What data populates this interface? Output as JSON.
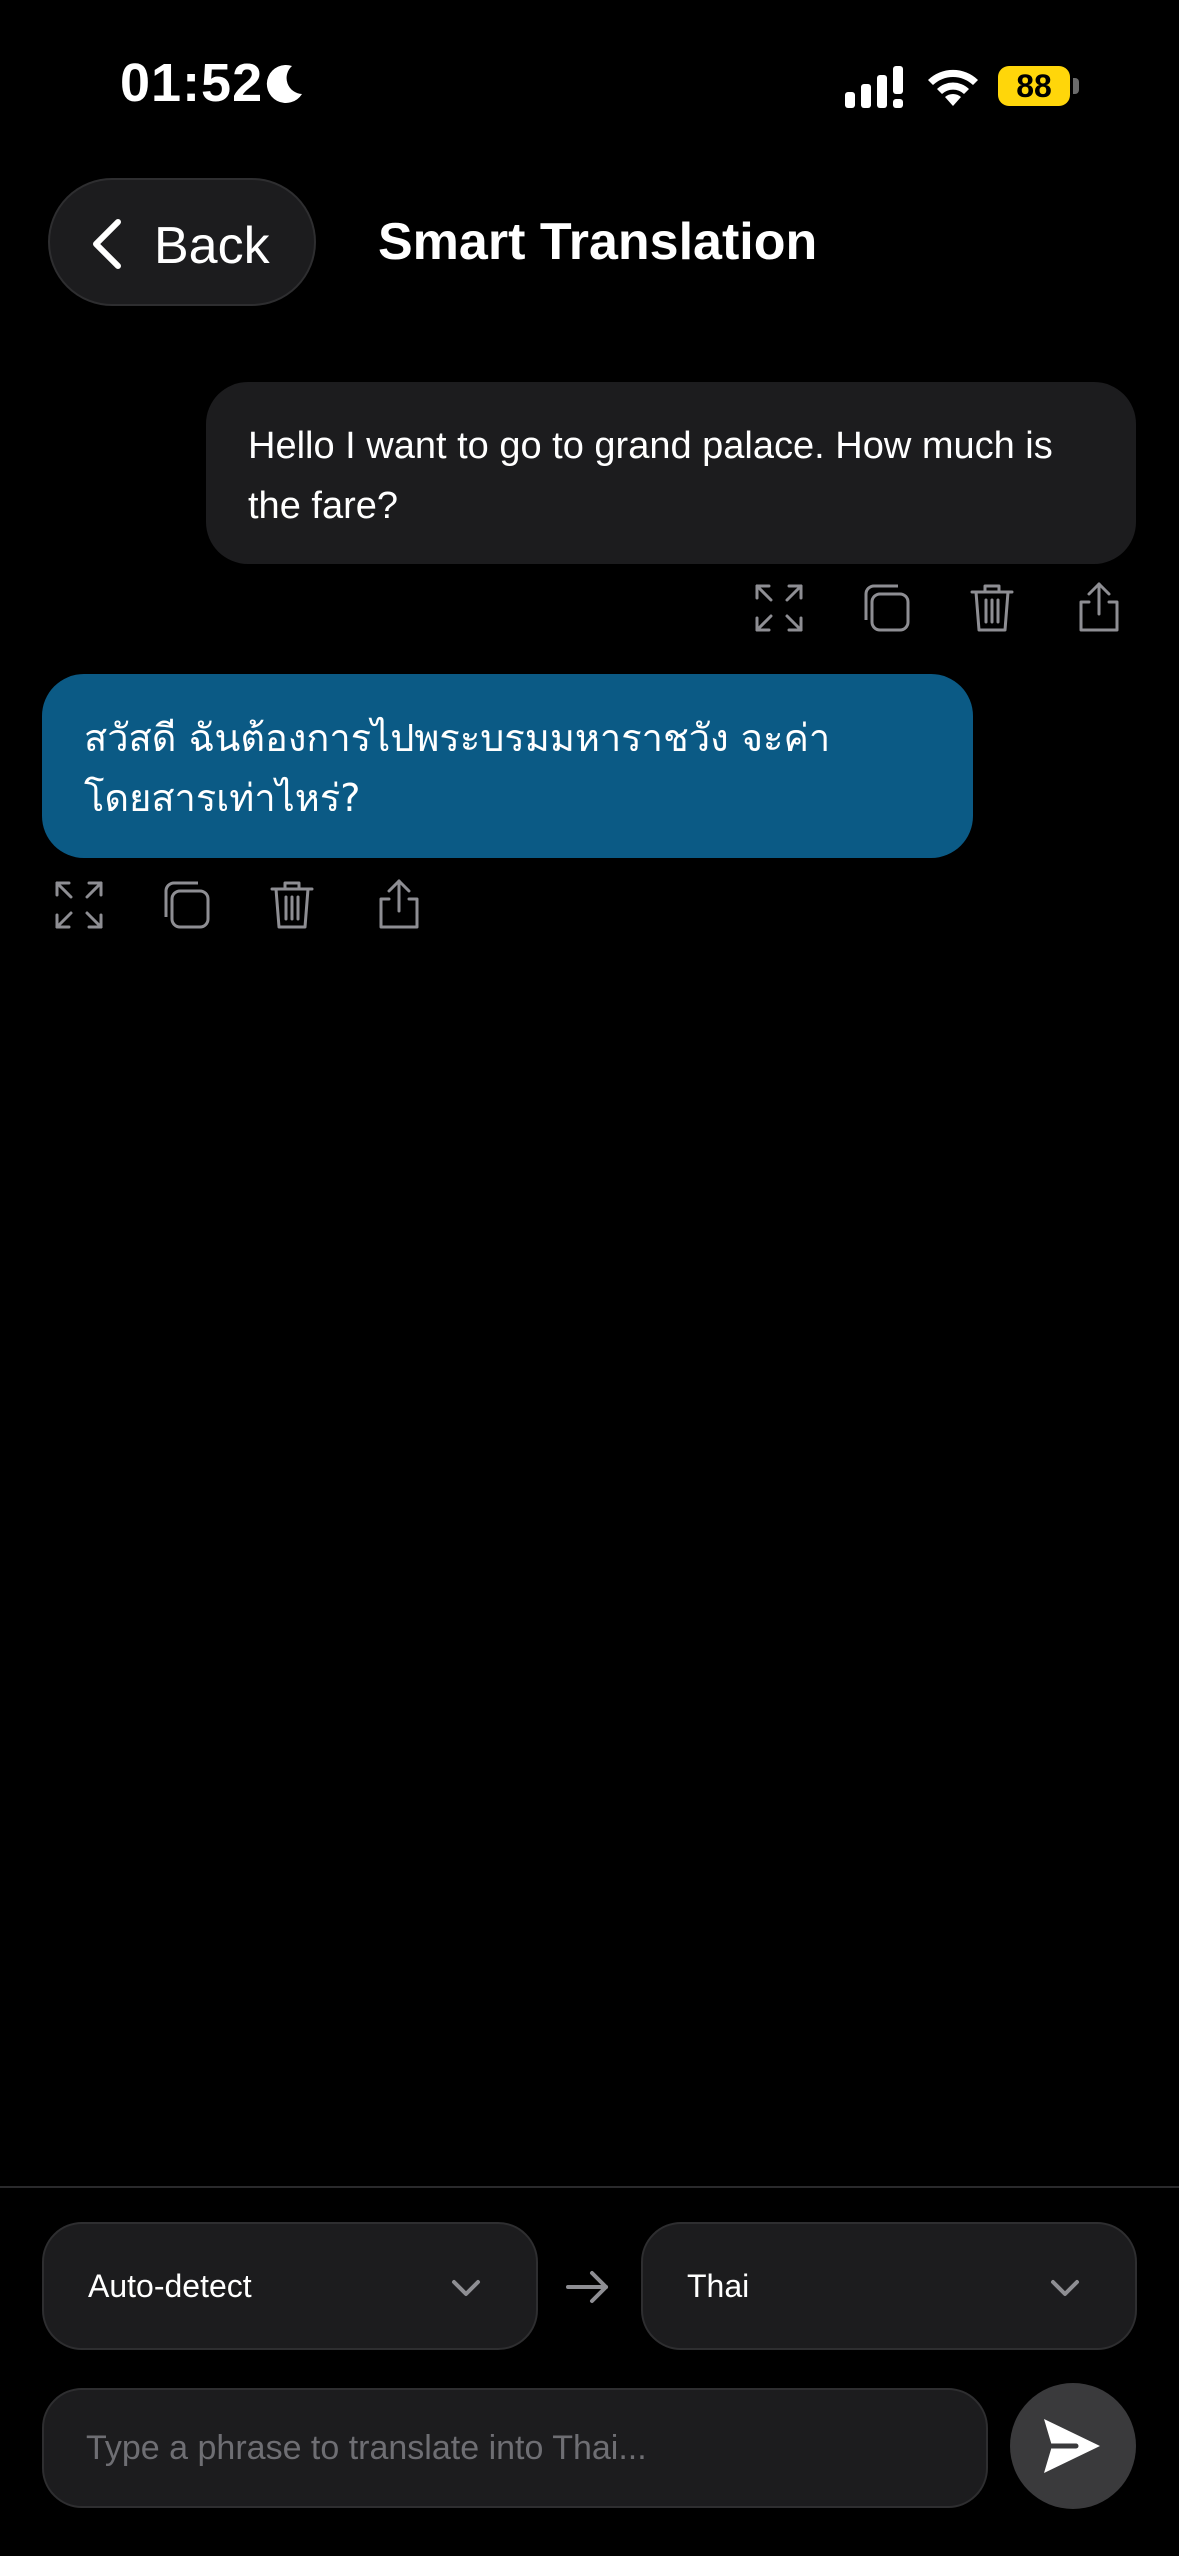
{
  "status_bar": {
    "time": "01:52",
    "battery": "88",
    "icons": [
      "moon-icon",
      "signal-icon",
      "wifi-icon",
      "battery-icon"
    ],
    "battery_color": "#ffd60a"
  },
  "header": {
    "back_label": "Back",
    "title": "Smart Translation"
  },
  "messages": [
    {
      "role": "source",
      "text": "Hello I want to go to grand palace. How much is the fare?",
      "actions": [
        "expand-icon",
        "copy-icon",
        "trash-icon",
        "share-icon"
      ]
    },
    {
      "role": "translation",
      "text": "สวัสดี ฉันต้องการไปพระบรมมหาราชวัง จะค่าโดยสารเท่าไหร่?",
      "actions": [
        "expand-icon",
        "copy-icon",
        "trash-icon",
        "share-icon"
      ]
    }
  ],
  "language_bar": {
    "from": "Auto-detect",
    "to": "Thai"
  },
  "input": {
    "placeholder": "Type a phrase to translate into Thai...",
    "value": ""
  },
  "colors": {
    "background": "#000000",
    "bubble_source": "#1c1c1e",
    "bubble_translation": "#0b5a85",
    "icon_gray": "#8e8e93"
  }
}
